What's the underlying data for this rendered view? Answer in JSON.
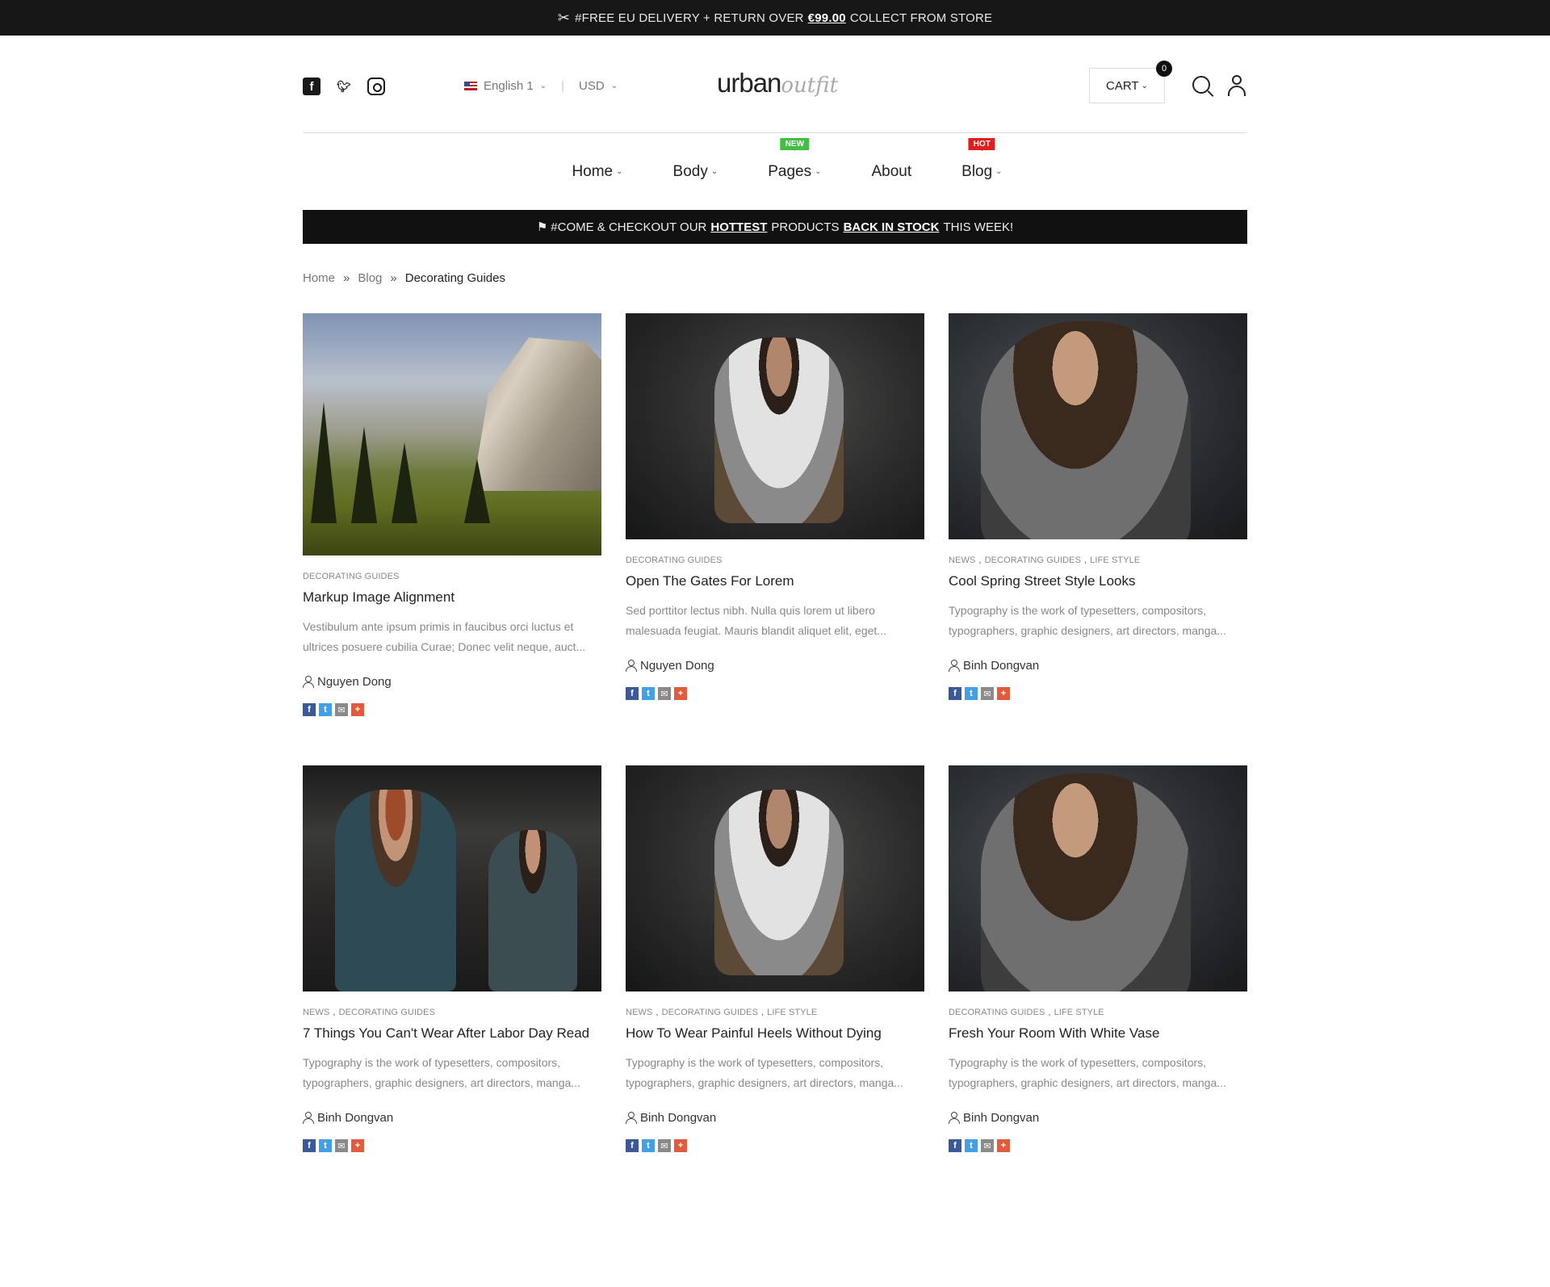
{
  "topbar": {
    "icon": "scissors-icon",
    "text_before": "#FREE EU DELIVERY + RETURN OVER",
    "price": "€99.00",
    "text_after": "COLLECT FROM STORE"
  },
  "header": {
    "language": "English 1",
    "currency": "USD",
    "logo_main": "urban",
    "logo_script": "outfit",
    "cart_label": "CART",
    "cart_count": "0"
  },
  "nav": {
    "items": [
      {
        "label": "Home",
        "badge": ""
      },
      {
        "label": "Body",
        "badge": ""
      },
      {
        "label": "Pages",
        "badge": "NEW"
      },
      {
        "label": "About",
        "badge": ""
      },
      {
        "label": "Blog",
        "badge": "HOT"
      }
    ]
  },
  "promo": {
    "part1": "#COME & CHECKOUT OUR",
    "hottest": "HOTTEST",
    "part2": "PRODUCTS",
    "back": "BACK IN STOCK",
    "part3": "THIS WEEK!"
  },
  "breadcrumb": {
    "home": "Home",
    "blog": "Blog",
    "current": "Decorating Guides"
  },
  "posts": [
    {
      "categories": [
        "DECORATING GUIDES"
      ],
      "title": "Markup Image Alignment",
      "excerpt_line1": "Vestibulum ante ipsum primis in faucibus orci luctus et",
      "excerpt_line2": "ultrices posuere cubilia Curae; Donec velit neque, auct...",
      "author": "Nguyen Dong"
    },
    {
      "categories": [
        "DECORATING GUIDES"
      ],
      "title": "Open The Gates For Lorem",
      "excerpt_line1": "Sed porttitor lectus nibh. Nulla quis lorem ut libero",
      "excerpt_line2": "malesuada feugiat. Mauris blandit aliquet elit, eget...",
      "author": "Nguyen Dong"
    },
    {
      "categories": [
        "NEWS",
        "DECORATING GUIDES",
        "LIFE STYLE"
      ],
      "title": "Cool Spring Street Style Looks",
      "excerpt_line1": "Typography is the work of typesetters, compositors,",
      "excerpt_line2": "typographers, graphic designers, art directors, manga...",
      "author": "Binh Dongvan"
    },
    {
      "categories": [
        "NEWS",
        "DECORATING GUIDES"
      ],
      "title": "7 Things You Can't Wear After Labor Day Read",
      "excerpt_line1": "Typography is the work of typesetters, compositors,",
      "excerpt_line2": "typographers, graphic designers, art directors, manga...",
      "author": "Binh Dongvan"
    },
    {
      "categories": [
        "NEWS",
        "DECORATING GUIDES",
        "LIFE STYLE"
      ],
      "title": "How To Wear Painful Heels Without Dying",
      "excerpt_line1": "Typography is the work of typesetters, compositors,",
      "excerpt_line2": "typographers, graphic designers, art directors, manga...",
      "author": "Binh Dongvan"
    },
    {
      "categories": [
        "DECORATING GUIDES",
        "LIFE STYLE"
      ],
      "title": "Fresh Your Room With White Vase",
      "excerpt_line1": "Typography is the work of typesetters, compositors,",
      "excerpt_line2": "typographers, graphic designers, art directors, manga...",
      "author": "Binh Dongvan"
    }
  ],
  "colors": {
    "badge_new": "#3fc043",
    "badge_hot": "#e01e1e",
    "bar": "#111111"
  }
}
